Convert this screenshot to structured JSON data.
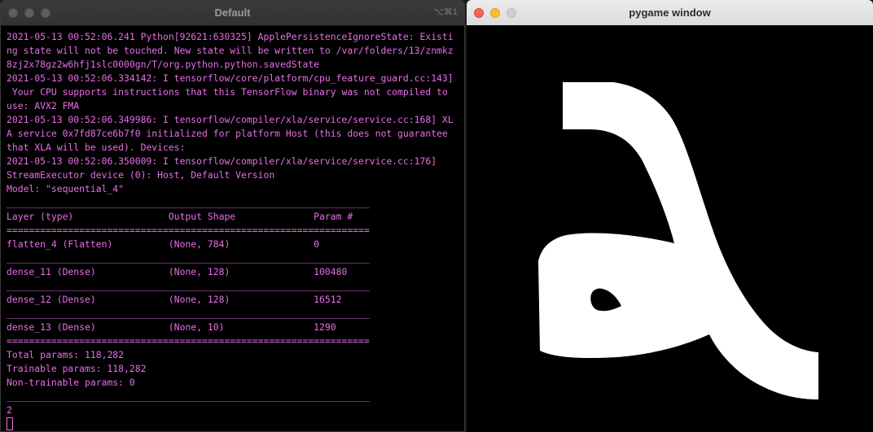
{
  "terminal": {
    "title": "Default",
    "shortcut": "⌥⌘1",
    "lines": [
      "2021-05-13 00:52:06.241 Python[92621:630325] ApplePersistenceIgnoreState: Existi",
      "ng state will not be touched. New state will be written to /var/folders/13/znmkz",
      "8zj2x78gz2w6hfj1slc0000gn/T/org.python.python.savedState",
      "2021-05-13 00:52:06.334142: I tensorflow/core/platform/cpu_feature_guard.cc:143]",
      " Your CPU supports instructions that this TensorFlow binary was not compiled to",
      "use: AVX2 FMA",
      "2021-05-13 00:52:06.349986: I tensorflow/compiler/xla/service/service.cc:168] XL",
      "A service 0x7fd87ce6b7f0 initialized for platform Host (this does not guarantee",
      "that XLA will be used). Devices:",
      "2021-05-13 00:52:06.350009: I tensorflow/compiler/xla/service/service.cc:176]",
      "StreamExecutor device (0): Host, Default Version",
      "Model: \"sequential_4\"",
      "_________________________________________________________________",
      "Layer (type)                 Output Shape              Param #",
      "=================================================================",
      "flatten_4 (Flatten)          (None, 784)               0",
      "_________________________________________________________________",
      "dense_11 (Dense)             (None, 128)               100480",
      "_________________________________________________________________",
      "dense_12 (Dense)             (None, 128)               16512",
      "_________________________________________________________________",
      "dense_13 (Dense)             (None, 10)                1290",
      "=================================================================",
      "Total params: 118,282",
      "Trainable params: 118,282",
      "Non-trainable params: 0",
      "_________________________________________________________________",
      "2"
    ]
  },
  "pygame": {
    "title": "pygame window"
  },
  "colors": {
    "terminal_text": "#e86ee8",
    "terminal_bg": "#000000",
    "canvas_bg": "#000000",
    "stroke": "#ffffff"
  }
}
